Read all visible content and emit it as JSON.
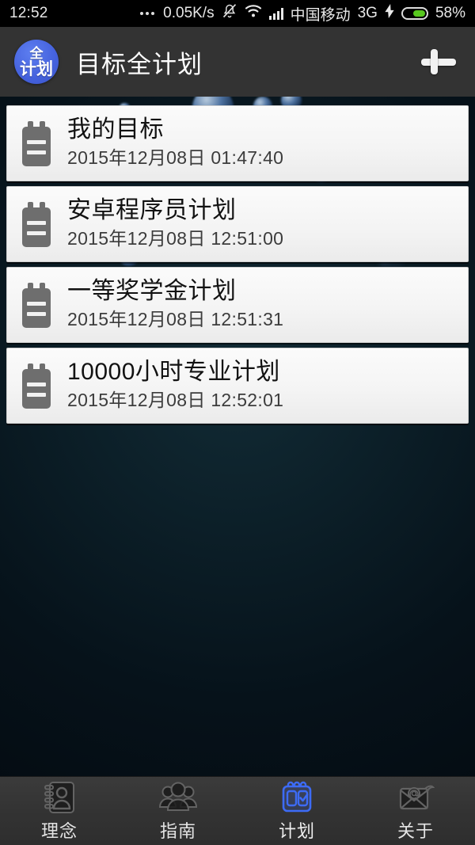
{
  "statusbar": {
    "clock": "12:52",
    "dots_icon": "more-dots-icon",
    "net_speed": "0.05K/s",
    "mute_icon": "bell-muted-icon",
    "wifi_icon": "wifi-icon",
    "signal_icon": "cellular-signal-icon",
    "carrier": "中国移动",
    "network_type": "3G",
    "charging_icon": "charging-bolt-icon",
    "battery_icon": "battery-icon",
    "battery_percent": "58%",
    "battery_level": 58
  },
  "appbar": {
    "logo_icon": "app-logo-icon",
    "logo_line1": "全",
    "logo_line2": "计划",
    "title": "目标全计划",
    "add_icon": "plus-icon"
  },
  "plans": [
    {
      "icon": "clipboard-icon",
      "title": "我的目标",
      "date": "2015年12月08日 01:47:40"
    },
    {
      "icon": "clipboard-icon",
      "title": "安卓程序员计划",
      "date": "2015年12月08日 12:51:00"
    },
    {
      "icon": "clipboard-icon",
      "title": "一等奖学金计划",
      "date": "2015年12月08日 12:51:31"
    },
    {
      "icon": "clipboard-icon",
      "title": "10000小时专业计划",
      "date": "2015年12月08日 12:52:01"
    }
  ],
  "bottom_nav": {
    "active_index": 2,
    "tabs": [
      {
        "label": "理念",
        "icon": "address-book-icon",
        "active": false
      },
      {
        "label": "指南",
        "icon": "people-group-icon",
        "active": false
      },
      {
        "label": "计划",
        "icon": "calendar-checklist-icon",
        "active": true
      },
      {
        "label": "关于",
        "icon": "envelope-at-icon",
        "active": false
      }
    ]
  },
  "colors": {
    "accent_blue": "#4a6ee0",
    "active_nav_blue": "#3d6bf5",
    "appbar_bg": "#333333",
    "status_bg": "#000000",
    "card_bg": "#f4f4f4",
    "battery_green": "#57c81e"
  }
}
